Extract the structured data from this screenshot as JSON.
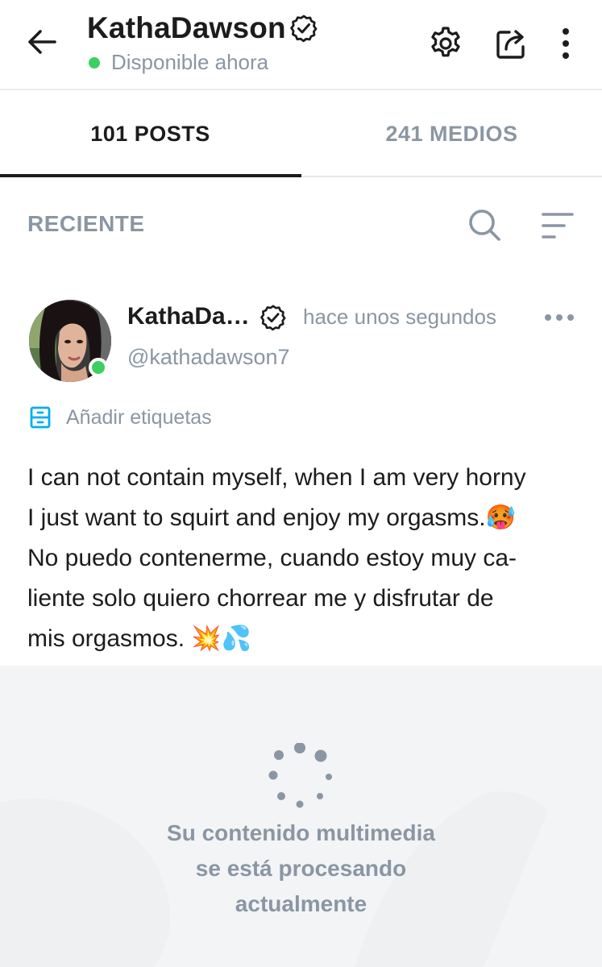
{
  "header": {
    "title": "KathaDawson",
    "status": "Disponible ahora",
    "icons": [
      "back-arrow-icon",
      "verified-icon",
      "gear-icon",
      "share-icon",
      "kebab-icon"
    ]
  },
  "tabs": [
    {
      "label": "101 POSTS",
      "active": true
    },
    {
      "label": "241 MEDIOS",
      "active": false
    }
  ],
  "sortbar": {
    "label": "RECIENTE",
    "icons": [
      "search-icon",
      "filter-icon"
    ]
  },
  "post": {
    "name": "KathaDa…",
    "time": "hace unos segundos",
    "handle": "@kathadawson7",
    "tags_label": "Añadir etiquetas",
    "text_lines": [
      "I can not contain myself, when I am very horny",
      "I just want to squirt and enjoy my orgasms.🥵",
      "No puedo contenerme, cuando estoy muy ca-",
      "liente solo quiero chorrear me y disfrutar de",
      "mis orgasmos. 💥💦"
    ]
  },
  "media": {
    "lines": [
      "Su contenido multimedia",
      "se está procesando",
      "actualmente"
    ]
  },
  "colors": {
    "accent_blue": "#00aff0",
    "online_green": "#3ccf61",
    "muted_gray": "#8a96a3",
    "text_dark": "#1c1c1c",
    "media_bg": "#f3f4f6"
  }
}
